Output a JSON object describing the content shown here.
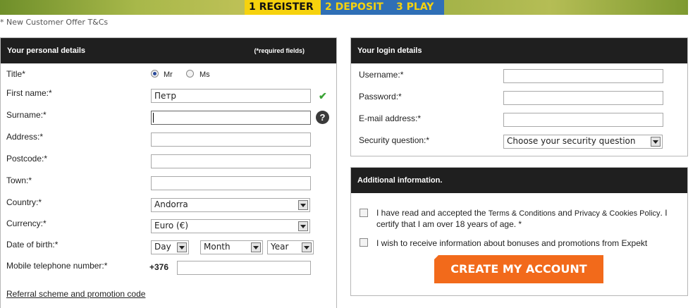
{
  "steps": [
    {
      "label": "1 REGISTER"
    },
    {
      "label": "2 DEPOSIT"
    },
    {
      "label": "3 PLAY"
    }
  ],
  "offer_note": "* New Customer Offer T&Cs",
  "personal": {
    "title": "Your personal details",
    "required_note": "(*required fields)",
    "title_label": "Title*",
    "title_options": [
      {
        "label": "Mr",
        "checked": true
      },
      {
        "label": "Ms",
        "checked": false
      }
    ],
    "first_name_label": "First name:*",
    "first_name_value": "Петр",
    "surname_label": "Surname:*",
    "surname_value": "",
    "address_label": "Address:*",
    "postcode_label": "Postcode:*",
    "town_label": "Town:*",
    "country_label": "Country:*",
    "country_value": "Andorra",
    "currency_label": "Currency:*",
    "currency_value": "Euro (€)",
    "dob_label": "Date of birth:*",
    "dob_day": "Day",
    "dob_month": "Month",
    "dob_year": "Year",
    "mobile_label": "Mobile telephone number:*",
    "mobile_prefix": "+376",
    "referral_link": "Referral scheme and promotion code"
  },
  "login": {
    "title": "Your login details",
    "username_label": "Username:*",
    "password_label": "Password:*",
    "email_label": "E-mail address:*",
    "security_label": "Security question:*",
    "security_value": "Choose your security question"
  },
  "additional": {
    "title": "Additional information.",
    "terms_pre": "I have read and accepted the ",
    "terms_link": "Terms & Conditions",
    "terms_and": " and ",
    "privacy_link": "Privacy & Cookies Policy",
    "terms_post": ". I",
    "terms_line2": "certify that I am over 18 years of age. *",
    "promo_text": "I wish to receive information about bonuses and promotions from Expekt",
    "create_button": "CREATE MY ACCOUNT"
  },
  "icons": {
    "valid": "check-icon",
    "help": "help-icon"
  },
  "colors": {
    "accent": "#f26a1b",
    "step_active": "#f6d20d",
    "step_inactive": "#2f6fb6",
    "header_bg": "#1f1f1f"
  }
}
